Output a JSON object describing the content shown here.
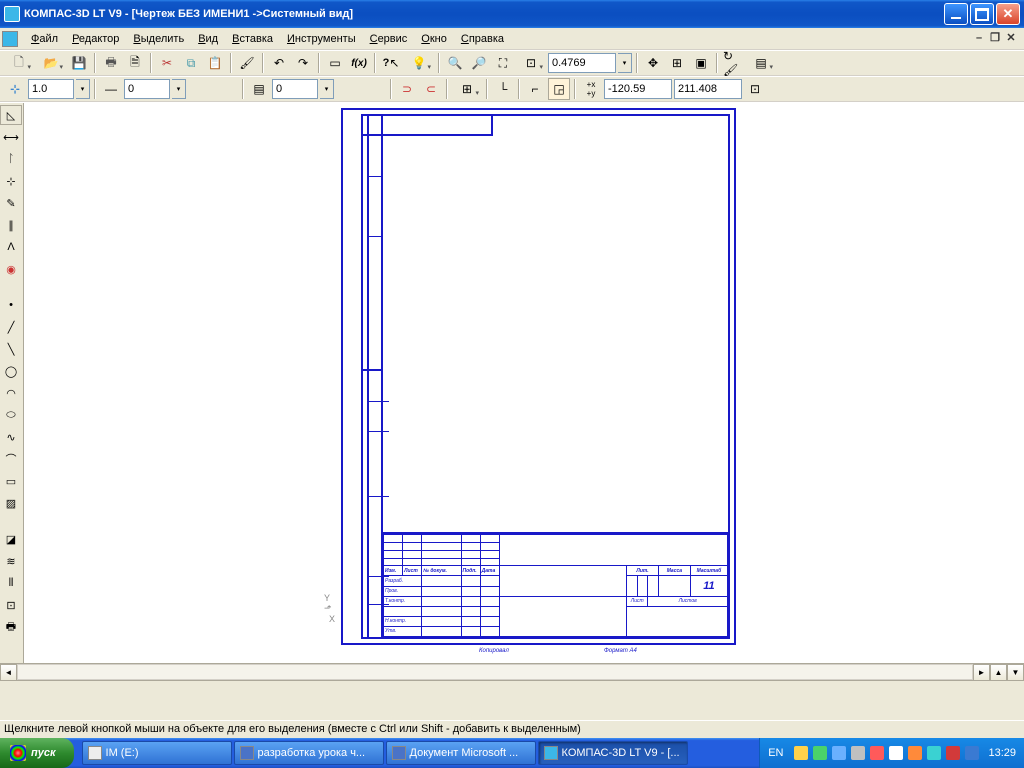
{
  "window": {
    "title": "КОМПАС-3D LT V9 - [Чертеж БЕЗ ИМЕНИ1 ->Системный вид]"
  },
  "menu": {
    "file": "Файл",
    "editor": "Редактор",
    "select": "Выделить",
    "view": "Вид",
    "insert": "Вставка",
    "tools": "Инструменты",
    "service": "Сервис",
    "window": "Окно",
    "help": "Справка"
  },
  "toolbar1": {
    "zoom_value": "0.4769"
  },
  "toolbar2": {
    "field1": "1.0",
    "field2": "0",
    "field3": "0",
    "coord_x": "-120.59",
    "coord_y": "211.408"
  },
  "stamp": {
    "number": "11",
    "lit": "Лит.",
    "mass": "Масса",
    "scale": "Масштаб",
    "list": "Лист",
    "lists": "Листов",
    "row_names": [
      "Изм.",
      "Лист",
      "№ докум.",
      "Подп.",
      "Дата"
    ],
    "rows": [
      "Разраб.",
      "Пров.",
      "Т.контр.",
      "",
      "Н.контр.",
      "Утв."
    ],
    "kopiroval": "Копировал",
    "format": "Формат  А4"
  },
  "status": {
    "text": "Щелкните левой кнопкой мыши на объекте для его выделения (вместе с Ctrl или Shift - добавить к выделенным)"
  },
  "taskbar": {
    "start": "пуск",
    "items": [
      {
        "label": "IM (E:)",
        "active": false
      },
      {
        "label": "разработка урока ч...",
        "active": false
      },
      {
        "label": "Документ Microsoft ...",
        "active": false
      },
      {
        "label": "КОМПАС-3D LT V9 - [...",
        "active": true
      }
    ],
    "lang": "EN",
    "clock": "13:29"
  }
}
